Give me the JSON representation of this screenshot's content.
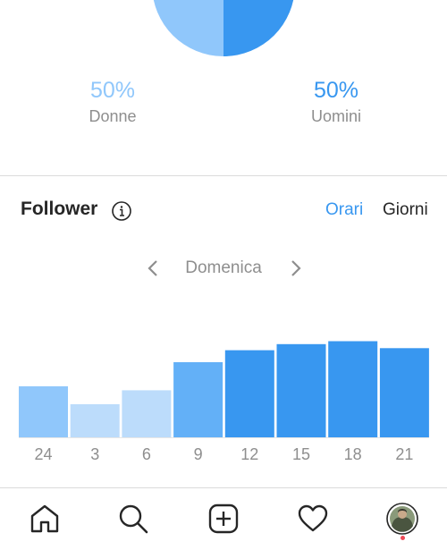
{
  "gender": [
    {
      "percent": "50%",
      "label": "Donne",
      "color": "#90c7fb"
    },
    {
      "percent": "50%",
      "label": "Uomini",
      "color": "#3897f0"
    }
  ],
  "followers": {
    "title": "Follower",
    "info_icon": "info-circle-icon",
    "tabs": {
      "hours": "Orari",
      "days": "Giorni"
    },
    "active_tab": "Orari",
    "day": "Domenica",
    "prev_icon": "chevron-left-icon",
    "next_icon": "chevron-right-icon"
  },
  "chart_data": {
    "type": "bar",
    "categories": [
      "24",
      "3",
      "6",
      "9",
      "12",
      "15",
      "18",
      "21"
    ],
    "values": [
      51,
      33,
      47,
      75,
      87,
      93,
      96,
      89
    ],
    "ylim": [
      0,
      100
    ],
    "grid": false,
    "colors": [
      "#90c7fb",
      "#bcdcfb",
      "#bcdcfb",
      "#63b0f7",
      "#3897f0",
      "#3897f0",
      "#3897f0",
      "#3897f0"
    ]
  },
  "tabbar": [
    "home-icon",
    "search-icon",
    "new-post-icon",
    "activity-heart-icon",
    "profile-avatar"
  ]
}
